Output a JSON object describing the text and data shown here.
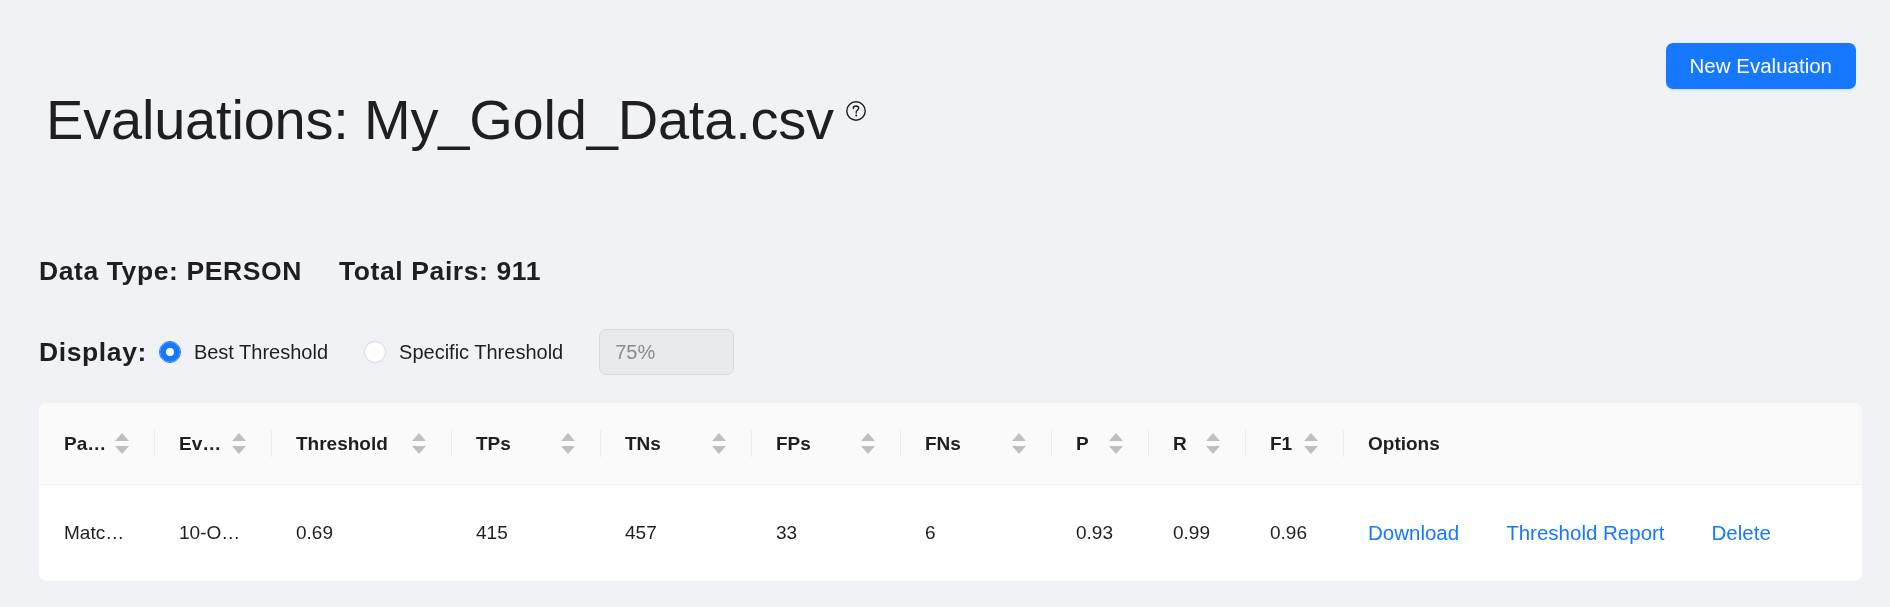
{
  "header": {
    "title": "Evaluations: My_Gold_Data.csv",
    "button": "New Evaluation"
  },
  "summary": [
    "Data Type: PERSON",
    "Total Pairs: 911"
  ],
  "display": {
    "label": "Display:",
    "options": [
      {
        "label": "Best Threshold",
        "selected": true
      },
      {
        "label": "Specific Threshold",
        "selected": false
      }
    ],
    "threshold_field": {
      "placeholder": "75%",
      "disabled": true
    }
  },
  "table": {
    "columns": [
      {
        "label": "Pa…",
        "sortable": true
      },
      {
        "label": "Ev…",
        "sortable": true
      },
      {
        "label": "Threshold",
        "sortable": true
      },
      {
        "label": "TPs",
        "sortable": true
      },
      {
        "label": "TNs",
        "sortable": true
      },
      {
        "label": "FPs",
        "sortable": true
      },
      {
        "label": "FNs",
        "sortable": true
      },
      {
        "label": "P",
        "sortable": true
      },
      {
        "label": "R",
        "sortable": true
      },
      {
        "label": "F1",
        "sortable": true
      },
      {
        "label": "Options",
        "sortable": false
      }
    ],
    "rows": [
      {
        "cells": [
          "Matc…",
          "10-O…",
          "0.69",
          "415",
          "457",
          "33",
          "6",
          "0.93",
          "0.99",
          "0.96"
        ],
        "actions": [
          "Download",
          "Threshold Report",
          "Delete"
        ]
      }
    ]
  }
}
